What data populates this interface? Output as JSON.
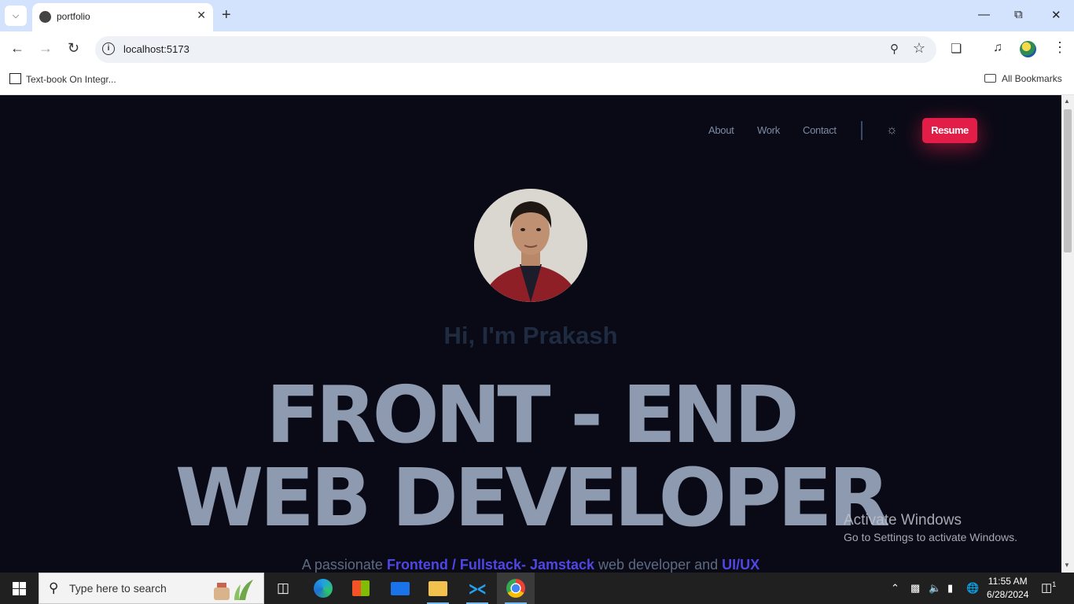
{
  "browser": {
    "tab_title": "portfolio",
    "url": "localhost:5173",
    "bookmarks": {
      "item1": "Text-book On Integr...",
      "all": "All Bookmarks"
    }
  },
  "site": {
    "nav": {
      "about": "About",
      "work": "Work",
      "contact": "Contact",
      "resume": "Resume"
    },
    "greeting": "Hi, I'm Prakash",
    "headline_line1": "FRONT - END",
    "headline_line2": "WEB DEVELOPER",
    "tagline": {
      "part1": "A passionate ",
      "highlight1": "Frontend / Fullstack- Jamstack",
      "part2": " web developer and ",
      "highlight2": "UI/UX"
    },
    "colors": {
      "background": "#0a0a16",
      "accent": "#e11d48",
      "highlight": "#4f46e5",
      "headline": "#8d9ab0"
    }
  },
  "watermark": {
    "line1": "Activate Windows",
    "line2": "Go to Settings to activate Windows."
  },
  "taskbar": {
    "search_placeholder": "Type here to search",
    "time": "11:55 AM",
    "date": "6/28/2024",
    "notification_count": "1"
  }
}
